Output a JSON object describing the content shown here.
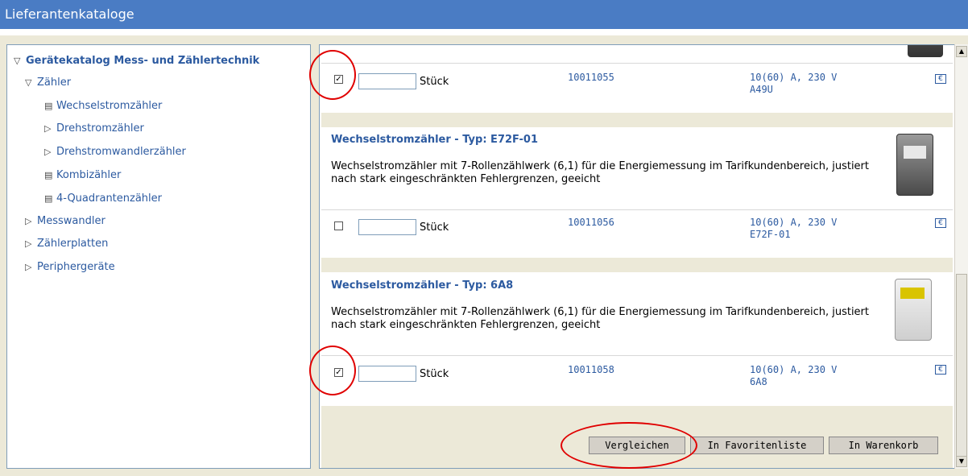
{
  "window": {
    "title": "Lieferantenkataloge"
  },
  "tree": {
    "root": "Gerätekatalog Mess- und Zählertechnik",
    "zaehler": "Zähler",
    "items": [
      "Wechselstromzähler",
      "Drehstromzähler",
      "Drehstromwandlerzähler",
      "Kombizähler",
      "4-Quadrantenzähler"
    ],
    "messwandler": "Messwandler",
    "zaehlerplatten": "Zählerplatten",
    "peripherie": "Peripher­geräte"
  },
  "products": [
    {
      "title": "",
      "desc": "",
      "checked": true,
      "unit": "Stück",
      "artno": "10011055",
      "spec1": "10(60) A, 230 V",
      "spec2": "A49U"
    },
    {
      "title": "Wechselstromzähler - Typ: E72F-01",
      "desc": "Wechselstromzähler mit 7-Rollenzählwerk (6,1) für die Energiemessung im Tarifkundenbereich, justiert nach stark eingeschränkten Fehlergrenzen, geeicht",
      "checked": false,
      "unit": "Stück",
      "artno": "10011056",
      "spec1": "10(60) A, 230 V",
      "spec2": "E72F-01"
    },
    {
      "title": "Wechselstromzähler - Typ: 6A8",
      "desc": "Wechselstromzähler mit 7-Rollenzählwerk (6,1) für die Energiemessung im Tarifkundenbereich, justiert nach stark eingeschränkten Fehlergrenzen, geeicht",
      "checked": true,
      "unit": "Stück",
      "artno": "10011058",
      "spec1": "10(60) A, 230 V",
      "spec2": "6A8"
    }
  ],
  "euro_symbol": "€",
  "check_mark": "✓",
  "buttons": {
    "compare": "Vergleichen",
    "favorites": "In Favoritenliste",
    "cart": "In Warenkorb"
  },
  "colors": {
    "link": "#2c5aa0",
    "titlebar": "#4a7cc4",
    "highlight": "#e00000"
  }
}
